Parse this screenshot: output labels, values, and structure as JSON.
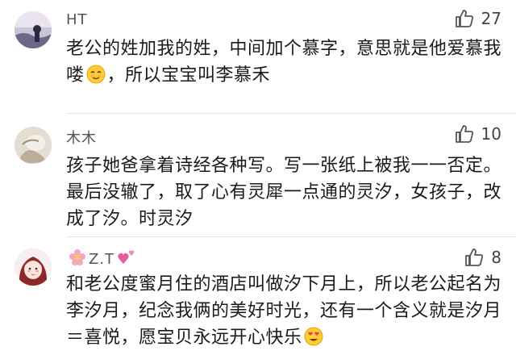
{
  "comments": [
    {
      "username": "HT",
      "likes": "27",
      "text_before_emoji": "老公的姓加我的姓，中间加个慕字，意思就是他爱慕我喽",
      "text_after_emoji": "，所以宝宝叫李慕禾",
      "emoji": "smiling-face-icon"
    },
    {
      "username": "木木",
      "likes": "10",
      "text": "孩子她爸拿着诗经各种写。写一张纸上被我一一否定。最后没辙了，取了心有灵犀一点通的灵汐，女孩子，改成了汐。时灵汐"
    },
    {
      "username": "Z.T",
      "likes": "8",
      "text_before_emoji": "和老公度蜜月住的酒店叫做汐下月上，所以老公起名为李汐月，纪念我俩的美好时光，还有一个含义就是汐月＝喜悦，愿宝贝永远开心快乐",
      "text_after_emoji": "",
      "emoji": "heart-eyes-face-icon",
      "name_decorations": [
        "flower-icon",
        "hearts-icon"
      ]
    }
  ],
  "colors": {
    "text": "#1a1a1a",
    "username": "#555555",
    "like_icon": "#555555",
    "divider": "#e6e6e6"
  }
}
